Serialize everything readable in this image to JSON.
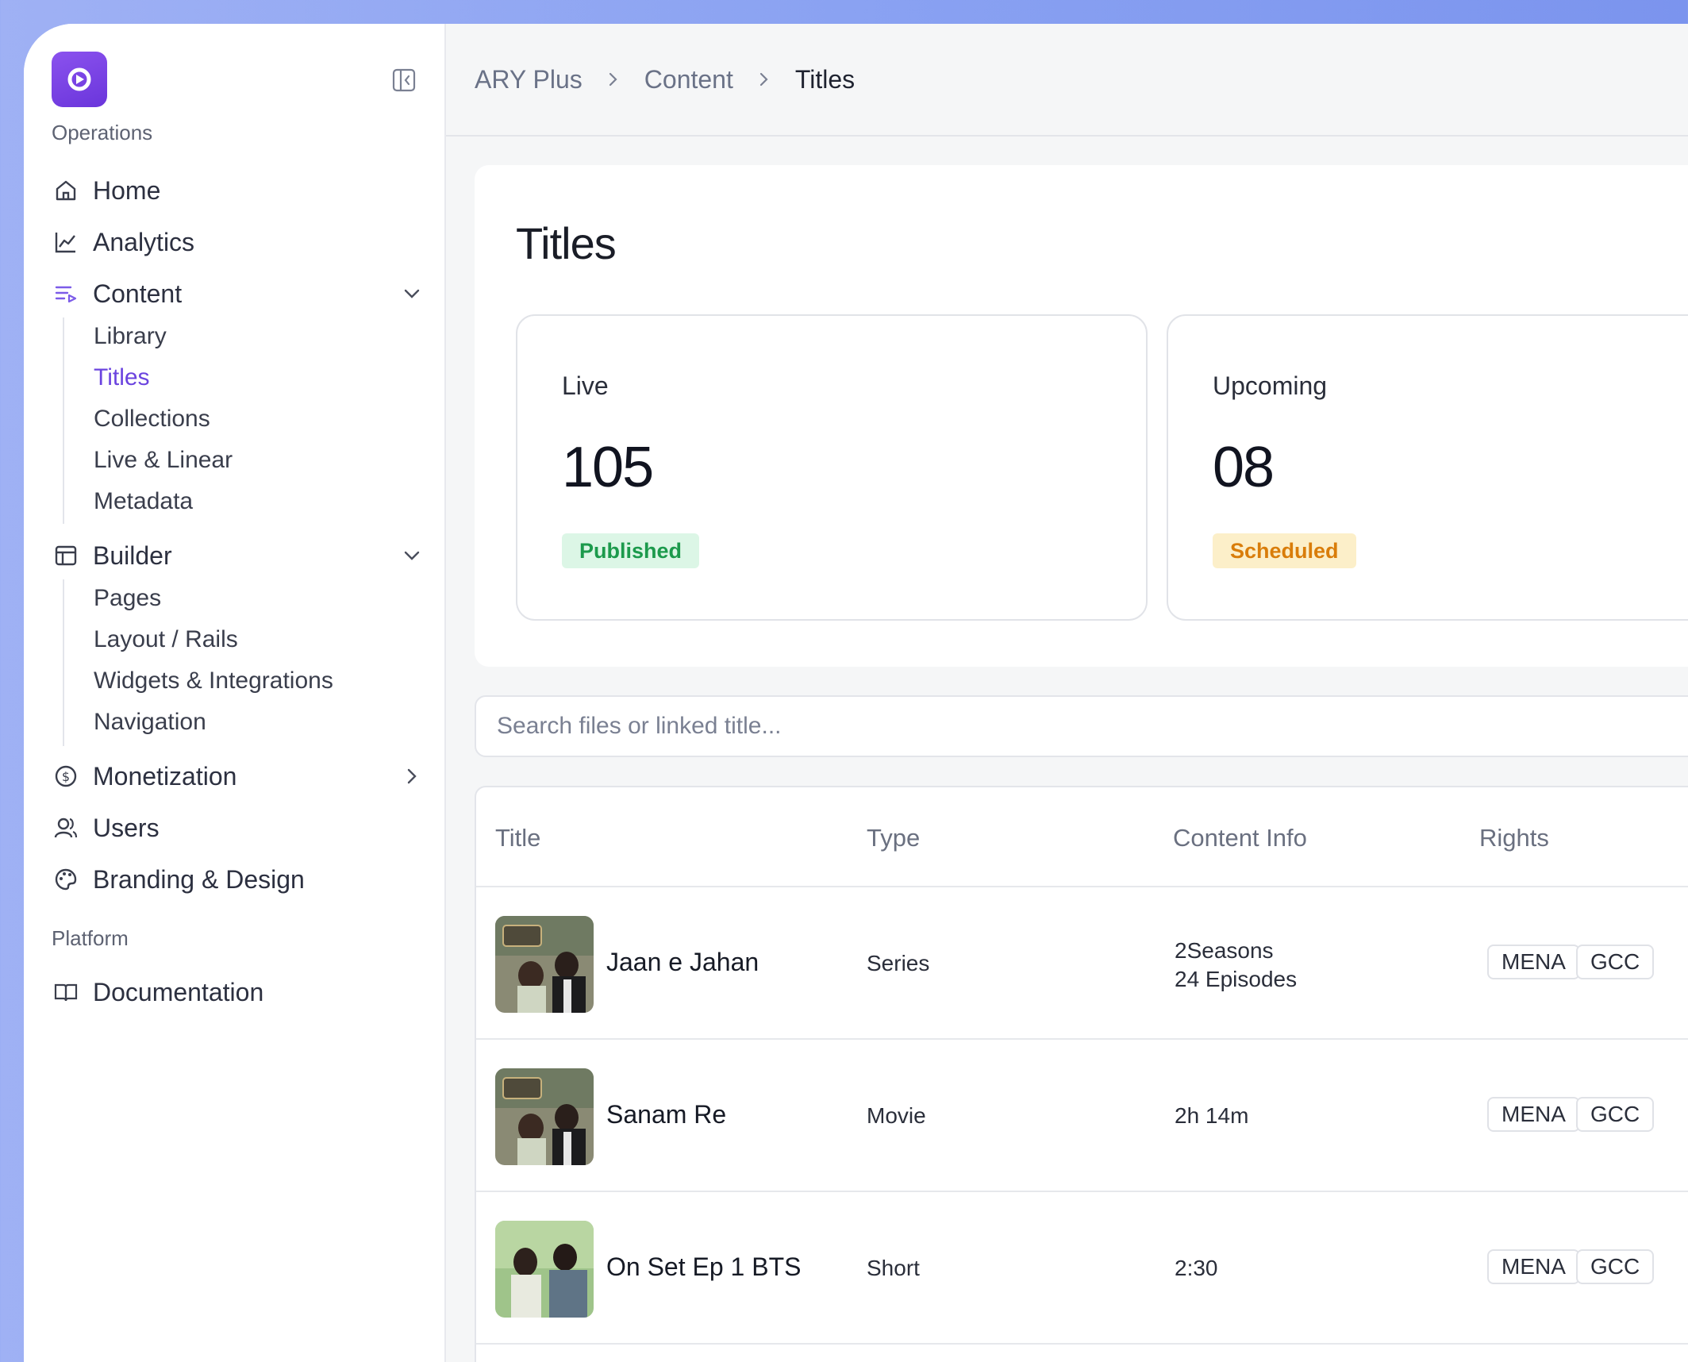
{
  "sidebar": {
    "section_operations": "Operations",
    "section_platform": "Platform",
    "items": {
      "home": "Home",
      "analytics": "Analytics",
      "content": "Content",
      "builder": "Builder",
      "monetization": "Monetization",
      "users": "Users",
      "branding": "Branding & Design",
      "documentation": "Documentation"
    },
    "content_sub": [
      "Library",
      "Titles",
      "Collections",
      "Live & Linear",
      "Metadata"
    ],
    "builder_sub": [
      "Pages",
      "Layout / Rails",
      "Widgets & Integrations",
      "Navigation"
    ],
    "active_item": "Titles"
  },
  "breadcrumb": [
    "ARY Plus",
    "Content",
    "Titles"
  ],
  "page": {
    "title": "Titles",
    "stats": [
      {
        "label": "Live",
        "value": "105",
        "badge": "Published",
        "badge_color": "#1c9a4c"
      },
      {
        "label": "Upcoming",
        "value": "08",
        "badge": "Scheduled",
        "badge_color": "#d97d0a"
      }
    ]
  },
  "search": {
    "placeholder": "Search files or linked title..."
  },
  "table": {
    "headers": [
      "Title",
      "Type",
      "Content Info",
      "Rights"
    ],
    "rows": [
      {
        "title": "Jaan e Jahan",
        "type": "Series",
        "info_line1": "2Seasons",
        "info_line2": "24 Episodes",
        "rights": [
          "MENA",
          "GCC"
        ]
      },
      {
        "title": "Sanam Re",
        "type": "Movie",
        "info_line1": "2h 14m",
        "info_line2": "",
        "rights": [
          "MENA",
          "GCC"
        ]
      },
      {
        "title": "On Set Ep 1 BTS",
        "type": "Short",
        "info_line1": "2:30",
        "info_line2": "",
        "rights": [
          "MENA",
          "GCC"
        ]
      }
    ]
  },
  "colors": {
    "accent": "#6b44df",
    "published": "#1c9a4c",
    "scheduled": "#d97d0a"
  }
}
